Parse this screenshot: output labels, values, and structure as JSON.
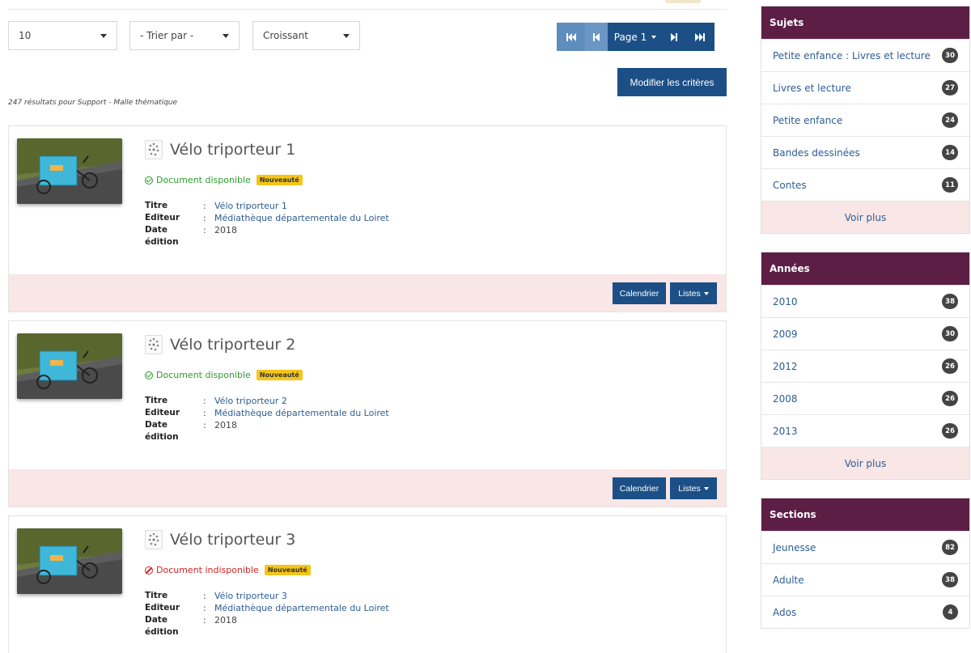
{
  "toolbar": {
    "per_page": "10",
    "sort_by": "- Trier par -",
    "order": "Croissant"
  },
  "pagination": {
    "first_icon": "⏮",
    "prev_icon": "⏴",
    "page_label": "Page 1",
    "next_icon": "⏵",
    "last_icon": "⏭"
  },
  "modify_button": "Modifier les critères",
  "result_count": "247 résultats pour Support - Malle thématique",
  "results": [
    {
      "title": "Vélo triporteur 1",
      "status": "Document disponible",
      "status_type": "available",
      "badge": "Nouveauté",
      "fields": [
        {
          "label": "Titre",
          "value": "Vélo triporteur 1"
        },
        {
          "label": "Editeur",
          "value": "Médiathèque départementale du Loiret"
        },
        {
          "label": "Date édition",
          "value": "2018"
        }
      ],
      "calendar_label": "Calendrier",
      "lists_label": "Listes"
    },
    {
      "title": "Vélo triporteur 2",
      "status": "Document disponible",
      "status_type": "available",
      "badge": "Nouveauté",
      "fields": [
        {
          "label": "Titre",
          "value": "Vélo triporteur 2"
        },
        {
          "label": "Editeur",
          "value": "Médiathèque départementale du Loiret"
        },
        {
          "label": "Date édition",
          "value": "2018"
        }
      ],
      "calendar_label": "Calendrier",
      "lists_label": "Listes"
    },
    {
      "title": "Vélo triporteur 3",
      "status": "Document indisponible",
      "status_type": "unavailable",
      "badge": "Nouveauté",
      "fields": [
        {
          "label": "Titre",
          "value": "Vélo triporteur 3"
        },
        {
          "label": "Editeur",
          "value": "Médiathèque départementale du Loiret"
        },
        {
          "label": "Date édition",
          "value": "2018"
        }
      ]
    }
  ],
  "facets": [
    {
      "title": "Sujets",
      "items": [
        {
          "label": "Petite enfance : Livres et lecture",
          "count": "30"
        },
        {
          "label": "Livres et lecture",
          "count": "27"
        },
        {
          "label": "Petite enfance",
          "count": "24"
        },
        {
          "label": "Bandes dessinées",
          "count": "14"
        },
        {
          "label": "Contes",
          "count": "11"
        }
      ],
      "more": "Voir plus"
    },
    {
      "title": "Années",
      "items": [
        {
          "label": "2010",
          "count": "38"
        },
        {
          "label": "2009",
          "count": "30"
        },
        {
          "label": "2012",
          "count": "26"
        },
        {
          "label": "2008",
          "count": "26"
        },
        {
          "label": "2013",
          "count": "26"
        }
      ],
      "more": "Voir plus"
    },
    {
      "title": "Sections",
      "items": [
        {
          "label": "Jeunesse",
          "count": "82"
        },
        {
          "label": "Adulte",
          "count": "38"
        },
        {
          "label": "Ados",
          "count": "4"
        }
      ]
    }
  ],
  "colors": {
    "primary": "#1c4f86",
    "facet_header": "#5d1e45",
    "available": "#2a9d2a",
    "unavailable": "#d02424",
    "badge": "#f5c518",
    "footer_bg": "#f9e6e6"
  }
}
